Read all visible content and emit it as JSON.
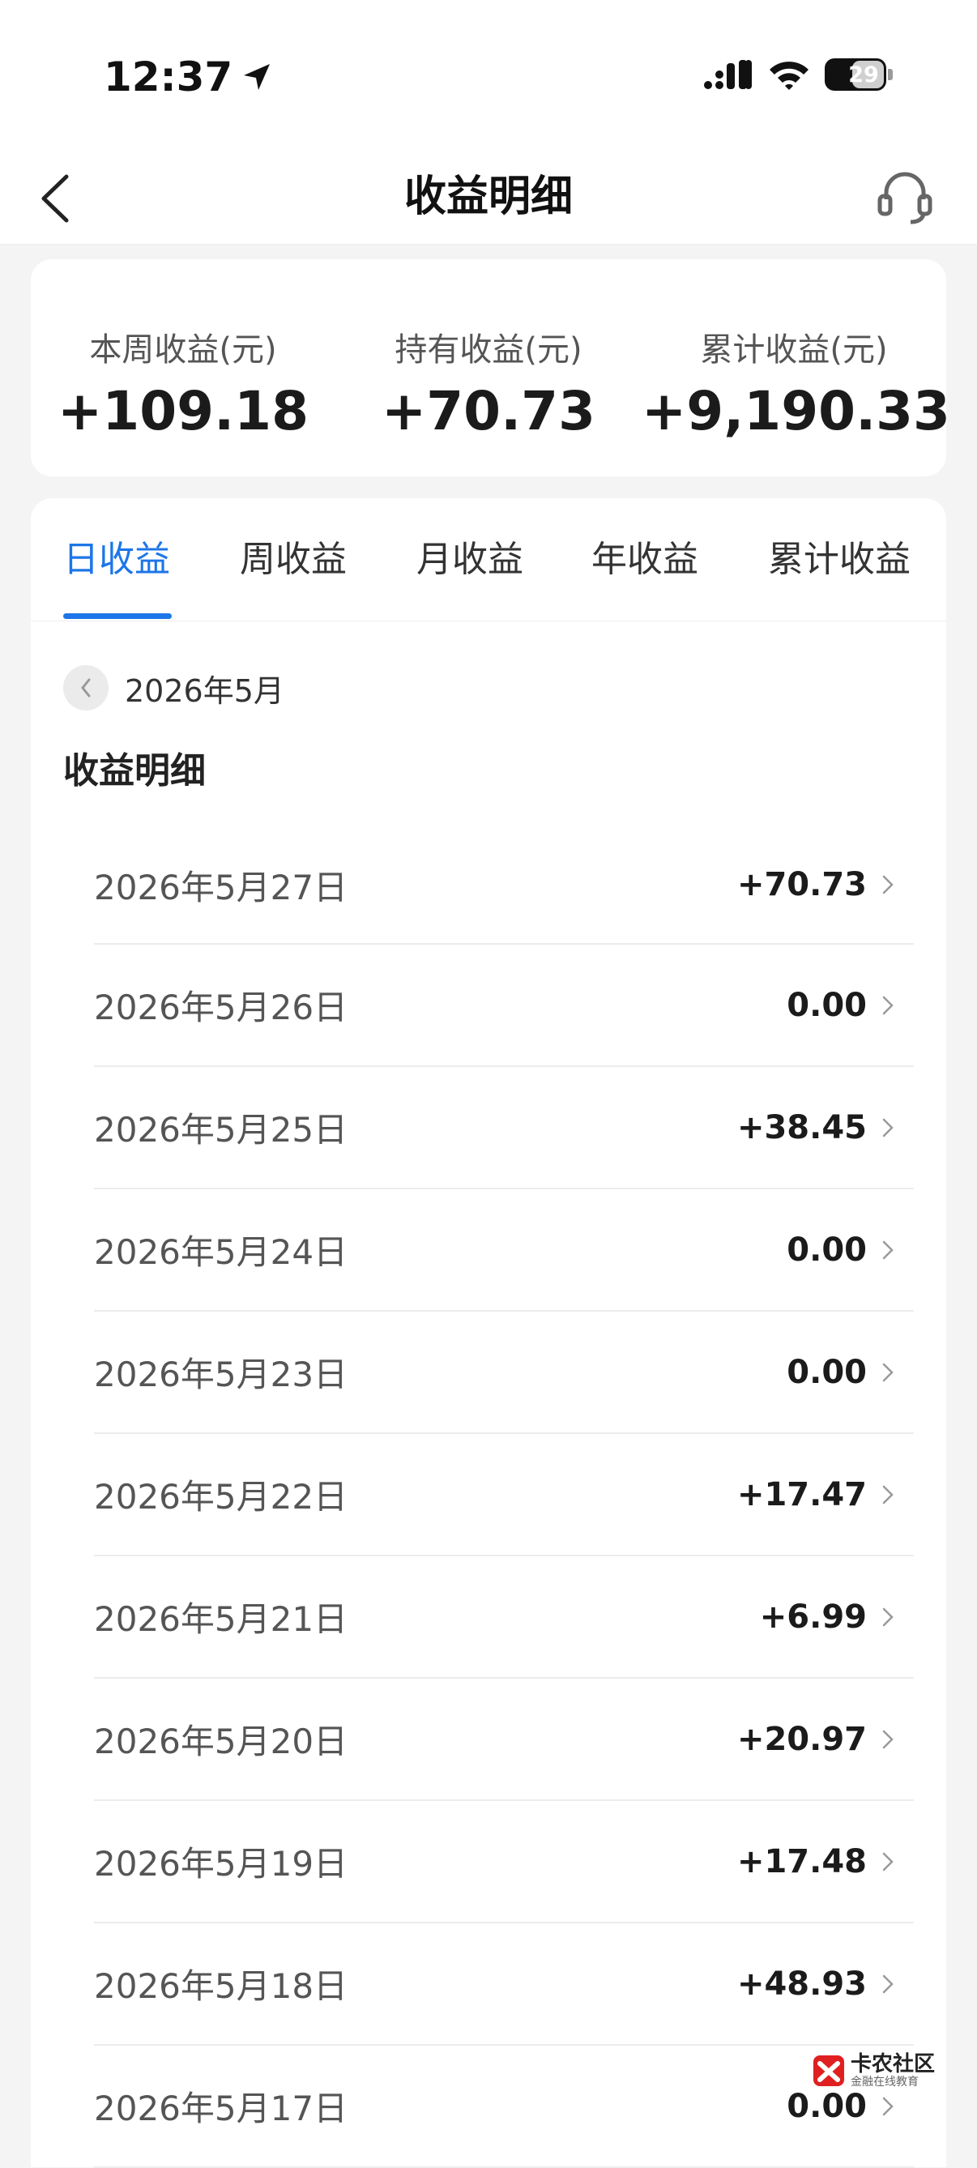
{
  "status_bar": {
    "time": "12:37",
    "battery": "29"
  },
  "nav": {
    "title": "收益明细"
  },
  "summary": [
    {
      "label": "本周收益(元)",
      "value": "+109.18"
    },
    {
      "label": "持有收益(元)",
      "value": "+70.73"
    },
    {
      "label": "累计收益(元)",
      "value": "+9,190.33"
    }
  ],
  "tabs": [
    {
      "label": "日收益",
      "active": true
    },
    {
      "label": "周收益",
      "active": false
    },
    {
      "label": "月收益",
      "active": false
    },
    {
      "label": "年收益",
      "active": false
    },
    {
      "label": "累计收益",
      "active": false
    }
  ],
  "month": "2026年5月",
  "section_title": "收益明细",
  "rows": [
    {
      "date": "2026年5月27日",
      "amount": "+70.73"
    },
    {
      "date": "2026年5月26日",
      "amount": "0.00"
    },
    {
      "date": "2026年5月25日",
      "amount": "+38.45"
    },
    {
      "date": "2026年5月24日",
      "amount": "0.00"
    },
    {
      "date": "2026年5月23日",
      "amount": "0.00"
    },
    {
      "date": "2026年5月22日",
      "amount": "+17.47"
    },
    {
      "date": "2026年5月21日",
      "amount": "+6.99"
    },
    {
      "date": "2026年5月20日",
      "amount": "+20.97"
    },
    {
      "date": "2026年5月19日",
      "amount": "+17.48"
    },
    {
      "date": "2026年5月18日",
      "amount": "+48.93"
    },
    {
      "date": "2026年5月17日",
      "amount": "0.00"
    }
  ],
  "watermark": {
    "title": "卡农社区",
    "subtitle": "金融在线教育"
  },
  "colors": {
    "accent": "#1d76e8",
    "background": "#f4f4f4"
  }
}
